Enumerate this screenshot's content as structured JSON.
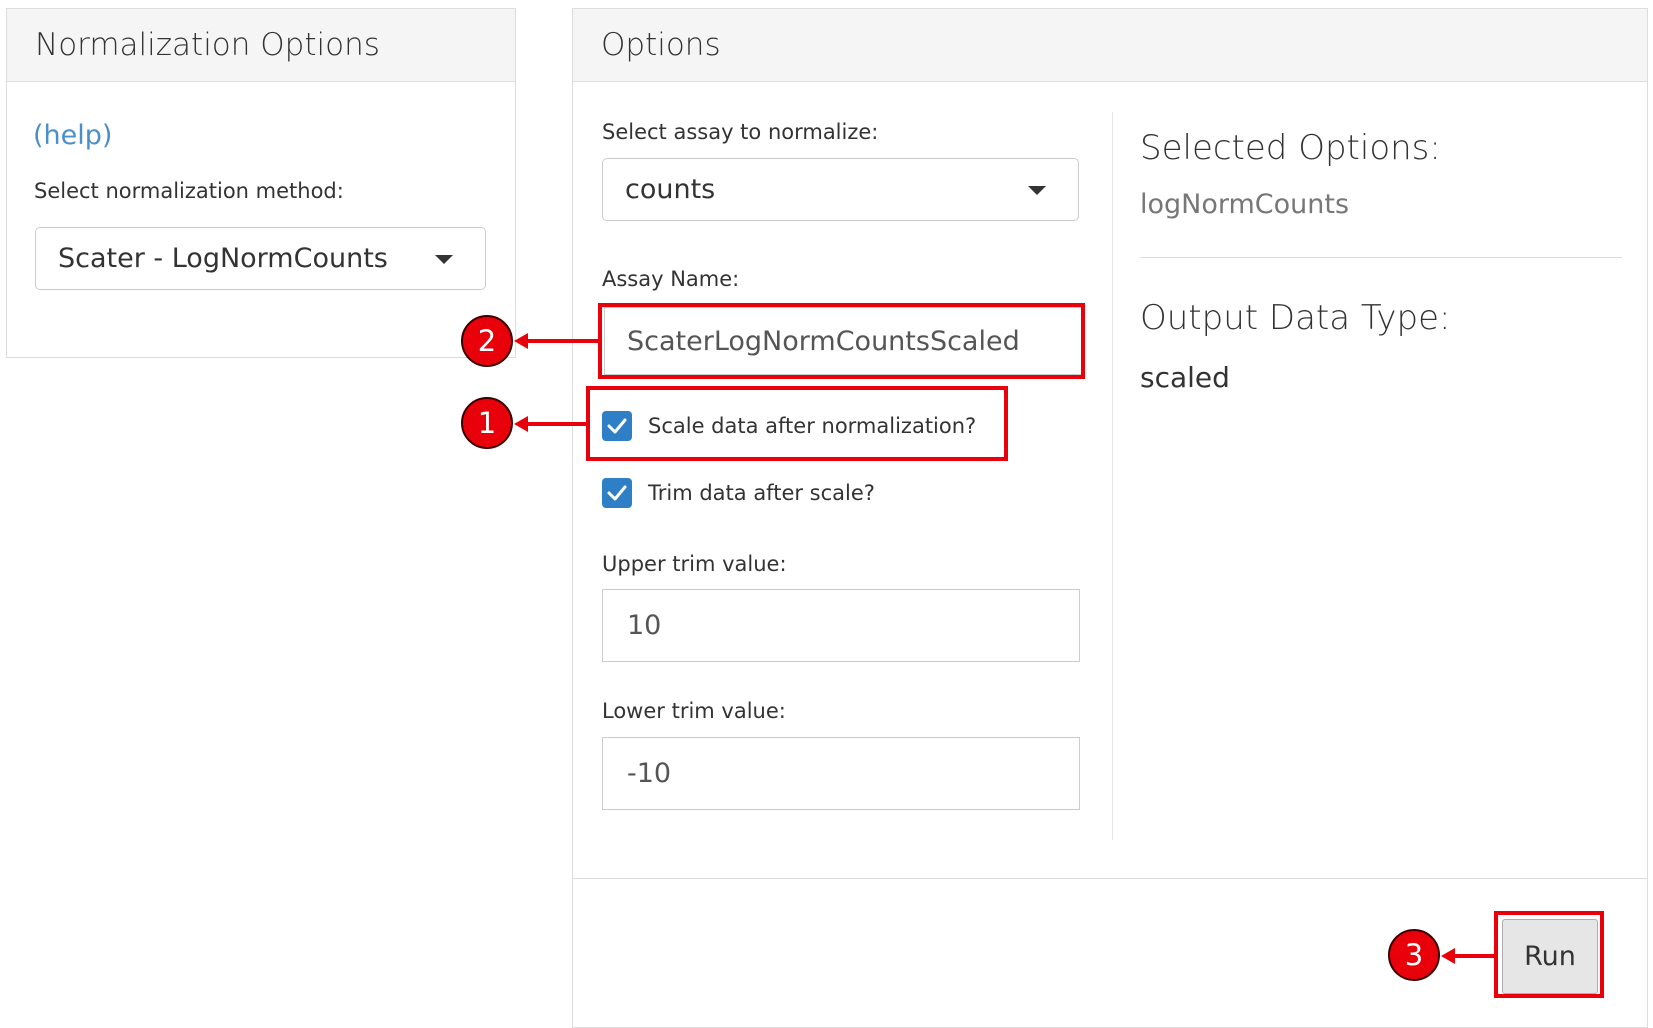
{
  "left_panel": {
    "title": "Normalization Options",
    "help_link": "(help)",
    "method_label": "Select normalization method:",
    "method_value": "Scater - LogNormCounts"
  },
  "right_panel": {
    "title": "Options",
    "assay_select_label": "Select assay to normalize:",
    "assay_select_value": "counts",
    "assay_name_label": "Assay Name:",
    "assay_name_value": "ScaterLogNormCountsScaled",
    "scale_checkbox": {
      "label": "Scale data after normalization?",
      "checked": true
    },
    "trim_checkbox": {
      "label": "Trim data after scale?",
      "checked": true
    },
    "upper_trim_label": "Upper trim value:",
    "upper_trim_value": "10",
    "lower_trim_label": "Lower trim value:",
    "lower_trim_value": "-10",
    "run_button": "Run"
  },
  "info": {
    "selected_options_heading": "Selected Options:",
    "selected_options_value": "logNormCounts",
    "output_type_heading": "Output Data Type:",
    "output_type_value": "scaled"
  },
  "annotations": {
    "marker_1": "1",
    "marker_2": "2",
    "marker_3": "3"
  },
  "colors": {
    "accent_blue": "#2f7fc6",
    "link_blue": "#4a8fc7",
    "annotation_red": "#e8000b"
  },
  "icons": {
    "dropdown": "caret-down-icon",
    "checked": "checkmark-icon"
  }
}
